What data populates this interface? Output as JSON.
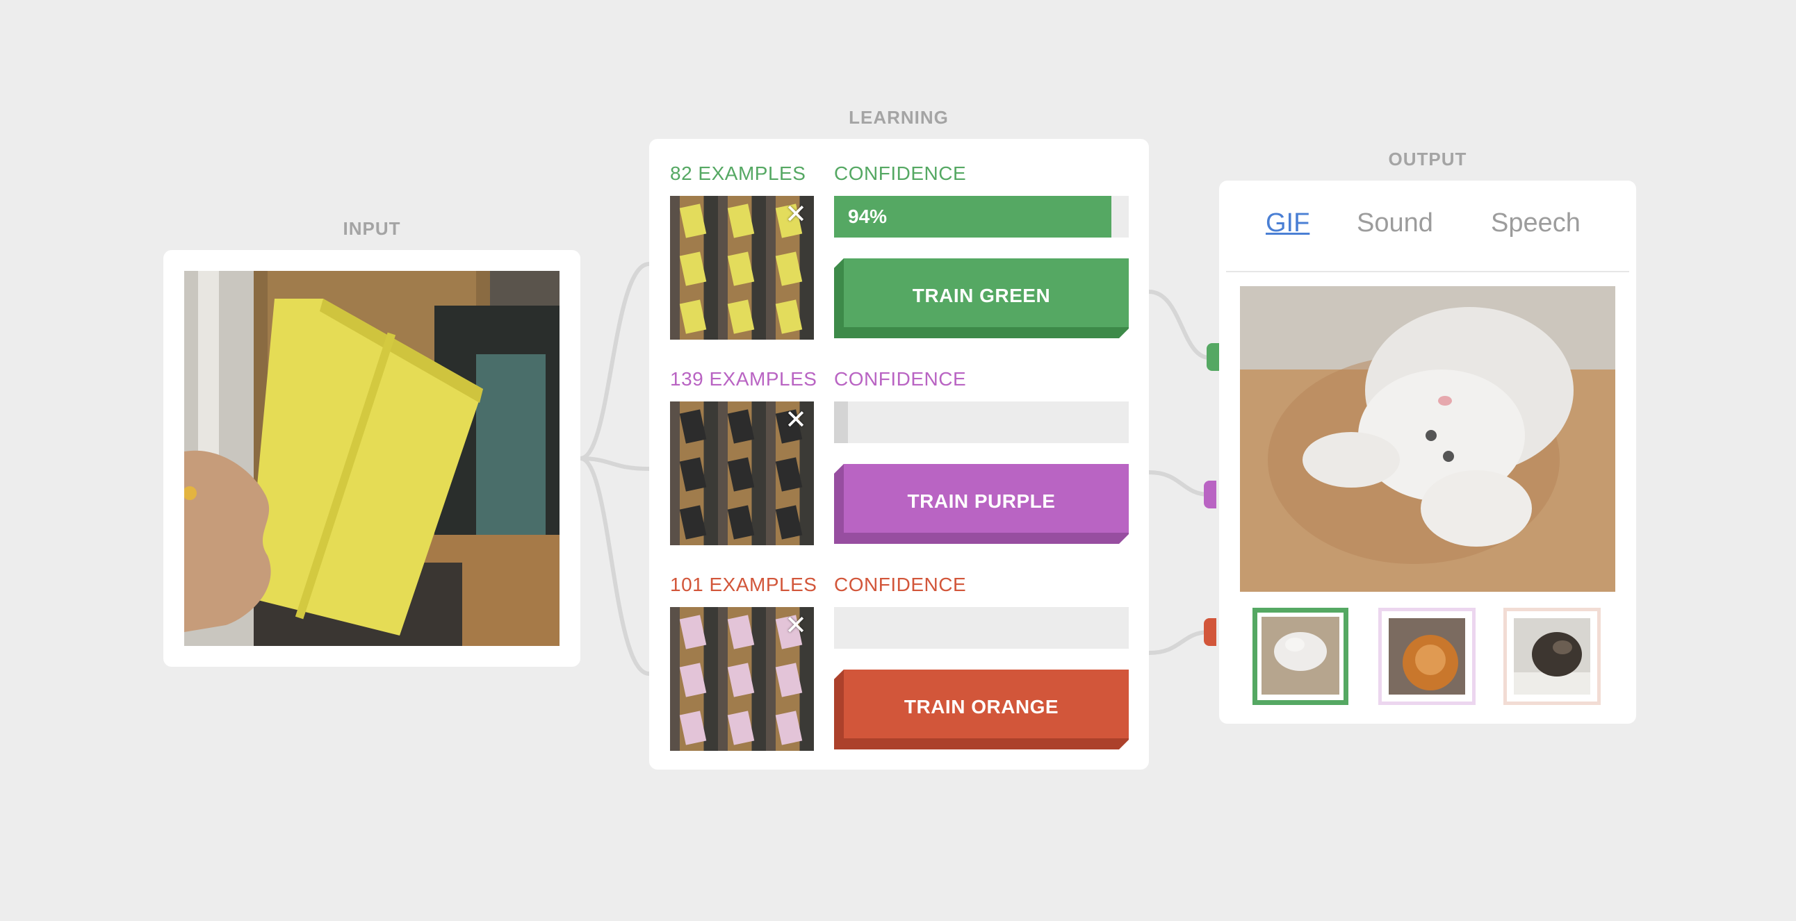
{
  "sections": {
    "input": "INPUT",
    "learning": "LEARNING",
    "output": "OUTPUT"
  },
  "classes": [
    {
      "examples_label": "82 EXAMPLES",
      "confidence_label": "CONFIDENCE",
      "confidence_value": 0.94,
      "confidence_text": "94%",
      "train_label": "TRAIN GREEN",
      "color": "#55a863",
      "dark": "#3d8a49",
      "tint": "#c9d9c4"
    },
    {
      "examples_label": "139 EXAMPLES",
      "confidence_label": "CONFIDENCE",
      "confidence_value": 0.04,
      "confidence_text": "",
      "train_label": "TRAIN PURPLE",
      "color": "#b964c3",
      "dark": "#974ea0",
      "tint": "#e6cfe8"
    },
    {
      "examples_label": "101 EXAMPLES",
      "confidence_label": "CONFIDENCE",
      "confidence_value": 0.0,
      "confidence_text": "",
      "train_label": "TRAIN ORANGE",
      "color": "#d2563a",
      "dark": "#ac412b",
      "tint": "#f0d4cc"
    }
  ],
  "output": {
    "tabs": [
      "GIF",
      "Sound",
      "Speech"
    ],
    "active_tab": "GIF",
    "selected_gif": 0,
    "gif_options": [
      "white-kitten",
      "pomeranian",
      "black-kitten"
    ]
  },
  "colors": {
    "background": "#ededed",
    "link": "#4a7fd4"
  }
}
